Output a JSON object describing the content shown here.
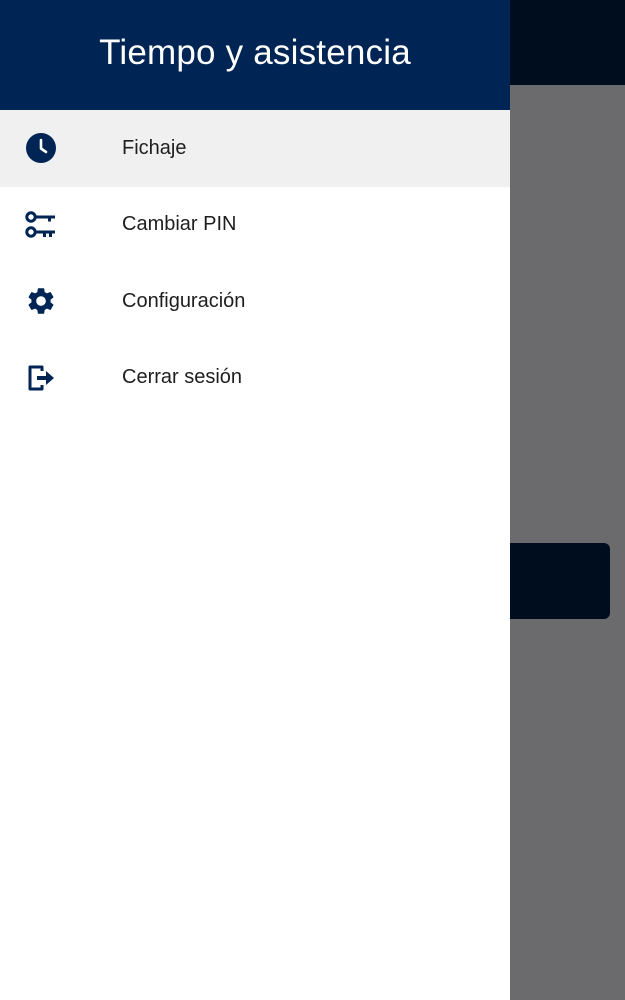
{
  "drawer": {
    "title": "Tiempo y asistencia",
    "items": [
      {
        "label": "Fichaje",
        "icon": "clock-icon",
        "selected": true
      },
      {
        "label": "Cambiar PIN",
        "icon": "key-icon",
        "selected": false
      },
      {
        "label": "Configuración",
        "icon": "gear-icon",
        "selected": false
      },
      {
        "label": "Cerrar sesión",
        "icon": "logout-icon",
        "selected": false
      }
    ]
  },
  "colors": {
    "header": "#002554",
    "icon": "#002554",
    "selected_bg": "#f0f0f1",
    "scrim": "#6b6b6d"
  }
}
